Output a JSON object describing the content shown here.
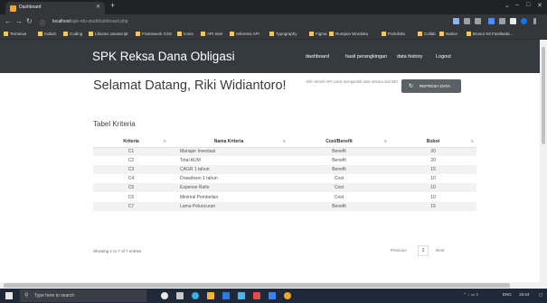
{
  "browser": {
    "tab_title": "Dashboard",
    "url_host": "localhost",
    "url_path": "/spk-rdo-stud/dashboard.php",
    "bookmarks": [
      "Terminus",
      "Kubuh",
      "Coding",
      "Liburan Javascript",
      "Framework CSS",
      "Icons",
      "API Intel",
      "referensi API",
      "Typography",
      "Figma",
      "Rumpun Wordoku",
      "Portofolio",
      "Collab",
      "Nation",
      "Brosur Kit Fastikeda..."
    ]
  },
  "app": {
    "brand": "SPK Reksa Dana Obligasi",
    "nav": [
      "dashboard",
      "hasil perangkingan",
      "data history",
      "Logout"
    ]
  },
  "welcome": "Selamat Datang, Riki Widiantoro!",
  "note": "Klik refresh API untuk mengambil data terbaru dari BEI",
  "refresh_label": "REFRESH DATA",
  "section_title": "Tabel Kriteria",
  "table": {
    "headers": [
      "Kriteria",
      "Nama Kriteria",
      "Cost/Benefit",
      "Bobot"
    ],
    "rows": [
      [
        "C1",
        "Manajer Investasi",
        "Benefit",
        "20"
      ],
      [
        "C2",
        "Total AUM",
        "Benefit",
        "20"
      ],
      [
        "C3",
        "CAGR 1 tahun",
        "Benefit",
        "15"
      ],
      [
        "C4",
        "Drawdown 1 tahun",
        "Cost",
        "10"
      ],
      [
        "C5",
        "Expense Ratio",
        "Cost",
        "10"
      ],
      [
        "C6",
        "Minimal Pembelian",
        "Cost",
        "10"
      ],
      [
        "C7",
        "Lama Peluncuran",
        "Benefit",
        "15"
      ]
    ]
  },
  "footer_text": "Showing 1 to 7 of 7 entries",
  "pagination": {
    "previous": "Previous",
    "current": "1",
    "next": "Next"
  },
  "taskbar": {
    "search_placeholder": "Type here to search",
    "tray_text": "ENG",
    "time": "19:44"
  }
}
